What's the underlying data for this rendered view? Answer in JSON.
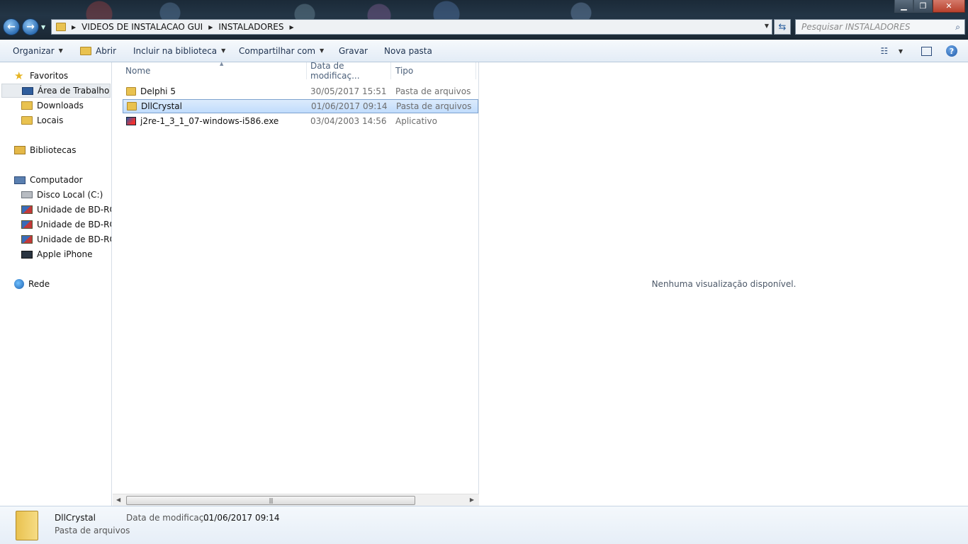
{
  "window": {
    "controls": {
      "minimize": "▁",
      "maximize": "❐",
      "close": "✕"
    }
  },
  "address": {
    "crumbs": [
      "VIDEOS DE INSTALACAO GUI",
      "INSTALADORES"
    ],
    "search_placeholder": "Pesquisar INSTALADORES"
  },
  "toolbar": {
    "organize": "Organizar",
    "open": "Abrir",
    "include_library": "Incluir na biblioteca",
    "share_with": "Compartilhar com",
    "burn": "Gravar",
    "new_folder": "Nova pasta"
  },
  "sidebar": {
    "favorites": "Favoritos",
    "desktop": "Área de Trabalho",
    "downloads": "Downloads",
    "places": "Locais",
    "libraries": "Bibliotecas",
    "computer": "Computador",
    "local_disk": "Disco Local (C:)",
    "bd1": "Unidade de BD-ROM",
    "bd2": "Unidade de BD-ROM",
    "bd3": "Unidade de BD-ROM",
    "iphone": "Apple iPhone",
    "network": "Rede"
  },
  "columns": {
    "name": "Nome",
    "date": "Data de modificaç...",
    "type": "Tipo"
  },
  "files": [
    {
      "name": "Delphi 5",
      "date": "30/05/2017 15:51",
      "type": "Pasta de arquivos"
    },
    {
      "name": "DllCrystal",
      "date": "01/06/2017 09:14",
      "type": "Pasta de arquivos"
    },
    {
      "name": "j2re-1_3_1_07-windows-i586.exe",
      "date": "03/04/2003 14:56",
      "type": "Aplicativo"
    }
  ],
  "preview": {
    "message": "Nenhuma visualização disponível."
  },
  "details": {
    "name": "DllCrystal",
    "type": "Pasta de arquivos",
    "date_label": "Data de modificaç...",
    "date_value": "01/06/2017 09:14"
  }
}
